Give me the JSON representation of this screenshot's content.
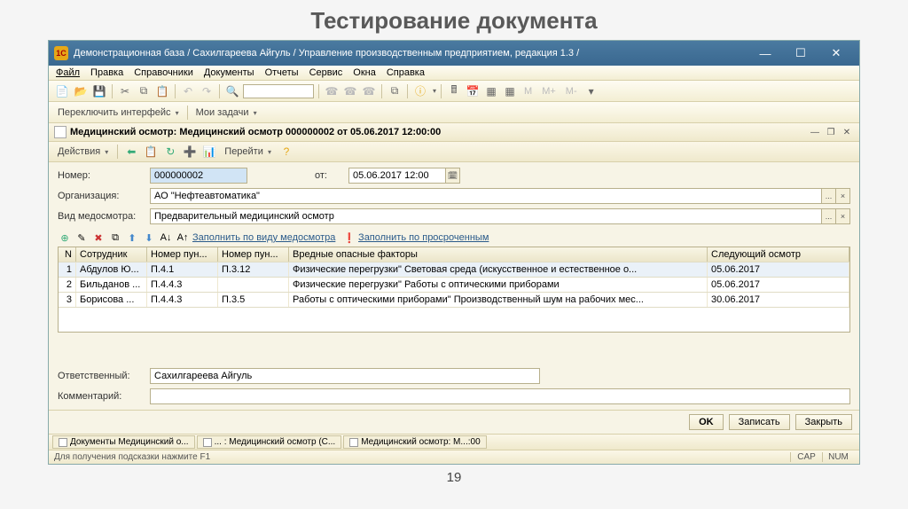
{
  "slide": {
    "title": "Тестирование документа",
    "page": "19"
  },
  "window": {
    "title": "Демонстрационная база / Сахилгареева Айгуль /  Управление производственным предприятием, редакция 1.3 /"
  },
  "menu": {
    "file": "Файл",
    "edit": "Правка",
    "refs": "Справочники",
    "docs": "Документы",
    "reports": "Отчеты",
    "service": "Сервис",
    "windows": "Окна",
    "help": "Справка"
  },
  "toolbar2": {
    "switch": "Переключить интерфейс ",
    "tasks": "Мои задачи "
  },
  "doc": {
    "header": "Медицинский осмотр: Медицинский осмотр 000000002 от 05.06.2017 12:00:00",
    "actions": "Действия ",
    "goto": "Перейти "
  },
  "form": {
    "number_label": "Номер:",
    "number_value": "000000002",
    "date_label": "от:",
    "date_value": "05.06.2017 12:00",
    "org_label": "Организация:",
    "org_value": "АО \"Нефтеавтоматика\"",
    "type_label": "Вид медосмотра:",
    "type_value": "Предварительный медицинский осмотр",
    "fill_by_type": "Заполнить по виду медосмотра",
    "fill_overdue": "Заполнить по просроченным",
    "resp_label": "Ответственный:",
    "resp_value": "Сахилгареева Айгуль",
    "comment_label": "Комментарий:",
    "comment_value": ""
  },
  "grid": {
    "headers": {
      "n": "N",
      "emp": "Сотрудник",
      "p1": "Номер пун...",
      "p2": "Номер пун...",
      "fac": "Вредные опасные факторы",
      "next": "Следующий осмотр"
    },
    "rows": [
      {
        "n": "1",
        "emp": "Абдулов Ю...",
        "p1": "П.4.1",
        "p2": "П.3.12",
        "fac": "Физические перегрузки\" Световая среда (искусственное и естественное о...",
        "next": "05.06.2017"
      },
      {
        "n": "2",
        "emp": "Бильданов ...",
        "p1": "П.4.4.3",
        "p2": "",
        "fac": "Физические перегрузки\" Работы с оптическими приборами",
        "next": "05.06.2017"
      },
      {
        "n": "3",
        "emp": "Борисова ...",
        "p1": "П.4.4.3",
        "p2": "П.3.5",
        "fac": "Работы с оптическими приборами\" Производственный шум на рабочих мес...",
        "next": "30.06.2017"
      }
    ]
  },
  "buttons": {
    "ok": "OK",
    "save": "Записать",
    "close": "Закрыть"
  },
  "tabs": {
    "t1": "Документы Медицинский о...",
    "t2": "... : Медицинский осмотр (С...",
    "t3": "Медицинский осмотр: М...:00"
  },
  "status": {
    "hint": "Для получения подсказки нажмите F1",
    "cap": "CAP",
    "num": "NUM"
  },
  "toolbar_text": {
    "m": "M",
    "mp": "M+",
    "mm": "M-"
  }
}
